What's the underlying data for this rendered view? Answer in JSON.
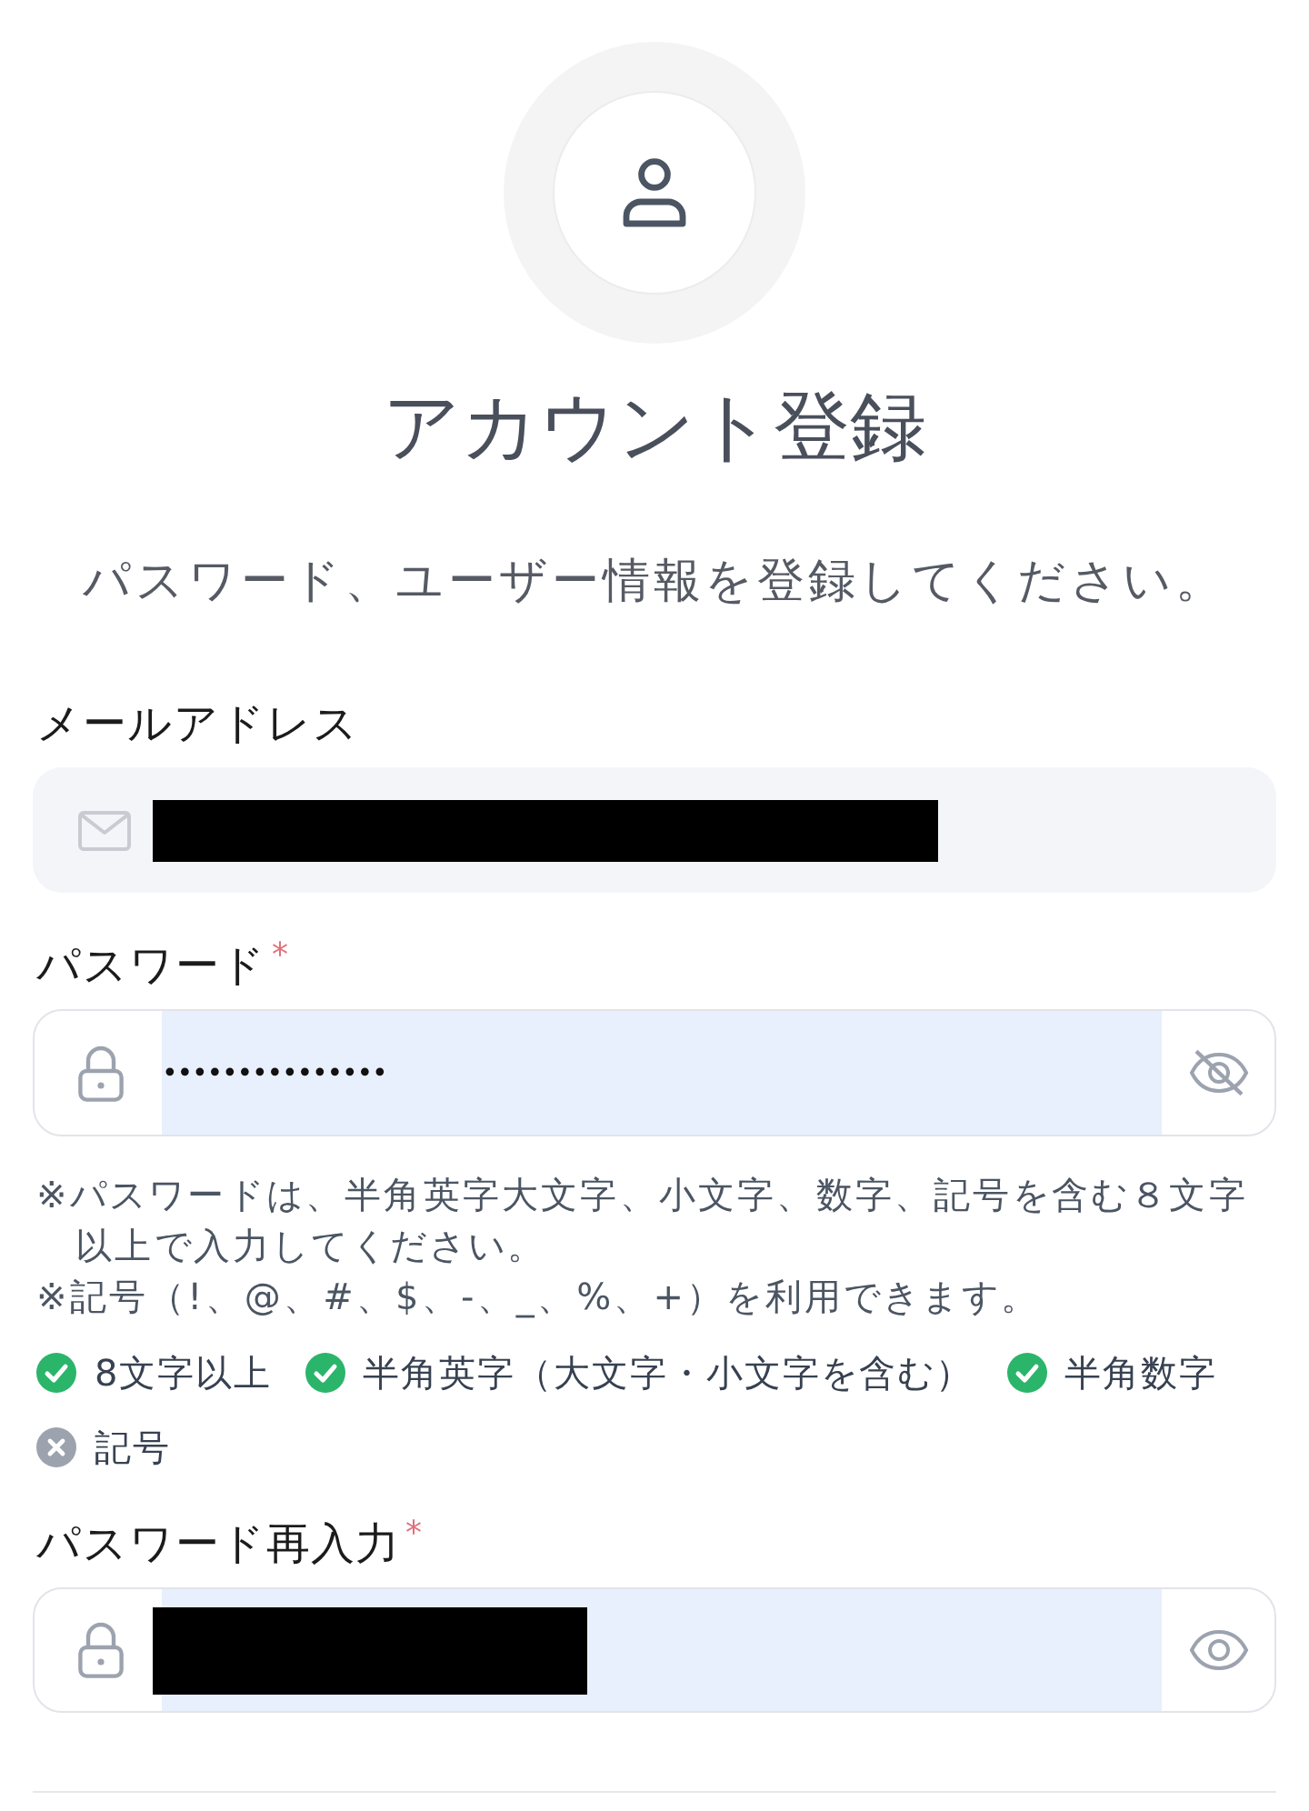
{
  "title": "アカウント登録",
  "subtitle": "パスワード、ユーザー情報を登録してください。",
  "email": {
    "label": "メールアドレス",
    "disabled": true,
    "redacted": true
  },
  "password": {
    "label": "パスワード",
    "required_mark": "*",
    "value": "•••••••••••••••",
    "autofilled": true,
    "masked": true
  },
  "notes": [
    "※パスワードは、半角英字大文字、小文字、数字、記号を含む８文字以上で入力してください。",
    "※記号（!、@、#、$、-、_、%、+）を利用できます。"
  ],
  "requirements": [
    {
      "label": "8文字以上",
      "met": true
    },
    {
      "label": "半角英字（大文字・小文字を含む）",
      "met": true
    },
    {
      "label": "半角数字",
      "met": true
    },
    {
      "label": "記号",
      "met": false
    }
  ],
  "password_confirm": {
    "label": "パスワード再入力",
    "required_mark": "*",
    "autofilled": true,
    "masked": false,
    "redacted": true
  }
}
